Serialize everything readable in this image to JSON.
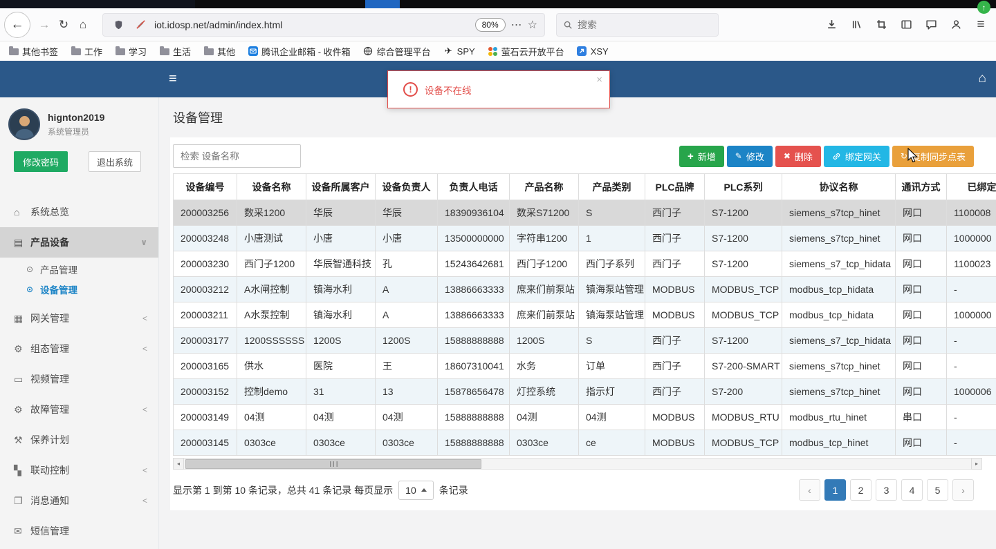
{
  "browser": {
    "nav": {
      "url": "iot.idosp.net/admin/index.html",
      "zoom": "80%",
      "search_placeholder": "搜索"
    },
    "bookmarks": [
      {
        "label": "其他书签",
        "icon": "folder"
      },
      {
        "label": "工作",
        "icon": "folder"
      },
      {
        "label": "学习",
        "icon": "folder"
      },
      {
        "label": "生活",
        "icon": "folder"
      },
      {
        "label": "其他",
        "icon": "folder"
      },
      {
        "label": "腾讯企业邮箱 - 收件箱",
        "icon": "mail"
      },
      {
        "label": "综合管理平台",
        "icon": "globe"
      },
      {
        "label": "SPY",
        "icon": "plane"
      },
      {
        "label": "萤石云开放平台",
        "icon": "dots"
      },
      {
        "label": "XSY",
        "icon": "xsy"
      }
    ]
  },
  "alert": {
    "message": "设备不在线",
    "close": "×"
  },
  "sidebar": {
    "username": "hignton2019",
    "role": "系统管理员",
    "change_password": "修改密码",
    "logout": "退出系统",
    "menu": [
      {
        "label": "系统总览",
        "icon": "home",
        "chevron": ""
      },
      {
        "label": "产品设备",
        "icon": "product",
        "chevron": "down",
        "active": true,
        "children": [
          {
            "label": "产品管理",
            "active": false
          },
          {
            "label": "设备管理",
            "active": true
          }
        ]
      },
      {
        "label": "网关管理",
        "icon": "gateway",
        "chevron": "left"
      },
      {
        "label": "组态管理",
        "icon": "gears",
        "chevron": "left"
      },
      {
        "label": "视频管理",
        "icon": "video",
        "chevron": ""
      },
      {
        "label": "故障管理",
        "icon": "gears",
        "chevron": "left"
      },
      {
        "label": "保养计划",
        "icon": "wrench",
        "chevron": ""
      },
      {
        "label": "联动控制",
        "icon": "link",
        "chevron": "left"
      },
      {
        "label": "消息通知",
        "icon": "message",
        "chevron": "left"
      },
      {
        "label": "短信管理",
        "icon": "sms",
        "chevron": ""
      }
    ]
  },
  "main": {
    "title": "设备管理",
    "search_placeholder": "检索 设备名称",
    "buttons": [
      {
        "key": "add",
        "label": "新增",
        "icon": "plus",
        "color": "#27a54b"
      },
      {
        "key": "edit",
        "label": "修改",
        "icon": "pencil",
        "color": "#1c84c6"
      },
      {
        "key": "delete",
        "label": "删除",
        "icon": "x",
        "color": "#e5524e"
      },
      {
        "key": "bind-gateway",
        "label": "绑定网关",
        "icon": "link",
        "color": "#23b7e5"
      },
      {
        "key": "copy-sync-table",
        "label": "复制同步点表",
        "icon": "refresh",
        "color": "#e9a03b"
      }
    ],
    "table": {
      "headers": [
        "设备编号",
        "设备名称",
        "设备所属客户",
        "设备负责人",
        "负责人电话",
        "产品名称",
        "产品类别",
        "PLC品牌",
        "PLC系列",
        "协议名称",
        "通讯方式",
        "已绑定网关"
      ],
      "selected_row_index": 0,
      "rows": [
        [
          "200003256",
          "数采1200",
          "华辰",
          "华辰",
          "18390936104",
          "数采S71200",
          "S",
          "西门子",
          "S7-1200",
          "siemens_s7tcp_hinet",
          "网口",
          "1100008"
        ],
        [
          "200003248",
          "小唐测试",
          "小唐",
          "小唐",
          "13500000000",
          "字符串1200",
          "1",
          "西门子",
          "S7-1200",
          "siemens_s7tcp_hinet",
          "网口",
          "1000000"
        ],
        [
          "200003230",
          "西门子1200",
          "华辰智通科技",
          "孔",
          "15243642681",
          "西门子1200",
          "西门子系列",
          "西门子",
          "S7-1200",
          "siemens_s7_tcp_hidata",
          "网口",
          "1100023"
        ],
        [
          "200003212",
          "A水闸控制",
          "镇海水利",
          "A",
          "13886663333",
          "庶来们前泵站",
          "镇海泵站管理",
          "MODBUS",
          "MODBUS_TCP",
          "modbus_tcp_hidata",
          "网口",
          "-"
        ],
        [
          "200003211",
          "A水泵控制",
          "镇海水利",
          "A",
          "13886663333",
          "庶来们前泵站",
          "镇海泵站管理",
          "MODBUS",
          "MODBUS_TCP",
          "modbus_tcp_hidata",
          "网口",
          "1000000"
        ],
        [
          "200003177",
          "1200SSSSSS",
          "1200S",
          "1200S",
          "15888888888",
          "1200S",
          "S",
          "西门子",
          "S7-1200",
          "siemens_s7_tcp_hidata",
          "网口",
          "-"
        ],
        [
          "200003165",
          "供水",
          "医院",
          "王",
          "18607310041",
          "水务",
          "订单",
          "西门子",
          "S7-200-SMART",
          "siemens_s7tcp_hinet",
          "网口",
          "-"
        ],
        [
          "200003152",
          "控制demo",
          "31",
          "13",
          "15878656478",
          "灯控系统",
          "指示灯",
          "西门子",
          "S7-200",
          "siemens_s7tcp_hinet",
          "网口",
          "1000006"
        ],
        [
          "200003149",
          "04测",
          "04测",
          "04测",
          "15888888888",
          "04测",
          "04测",
          "MODBUS",
          "MODBUS_RTU",
          "modbus_rtu_hinet",
          "串口",
          "-"
        ],
        [
          "200003145",
          "0303ce",
          "0303ce",
          "0303ce",
          "15888888888",
          "0303ce",
          "ce",
          "MODBUS",
          "MODBUS_TCP",
          "modbus_tcp_hinet",
          "网口",
          "-"
        ]
      ]
    },
    "pagination": {
      "summary_prefix": "显示第 1 到第 10 条记录，总共 41 条记录 每页显示",
      "page_size": "10",
      "summary_suffix": "条记录",
      "prev": "‹",
      "next": "›",
      "pages": [
        "1",
        "2",
        "3",
        "4",
        "5"
      ],
      "active_page": "1"
    }
  }
}
